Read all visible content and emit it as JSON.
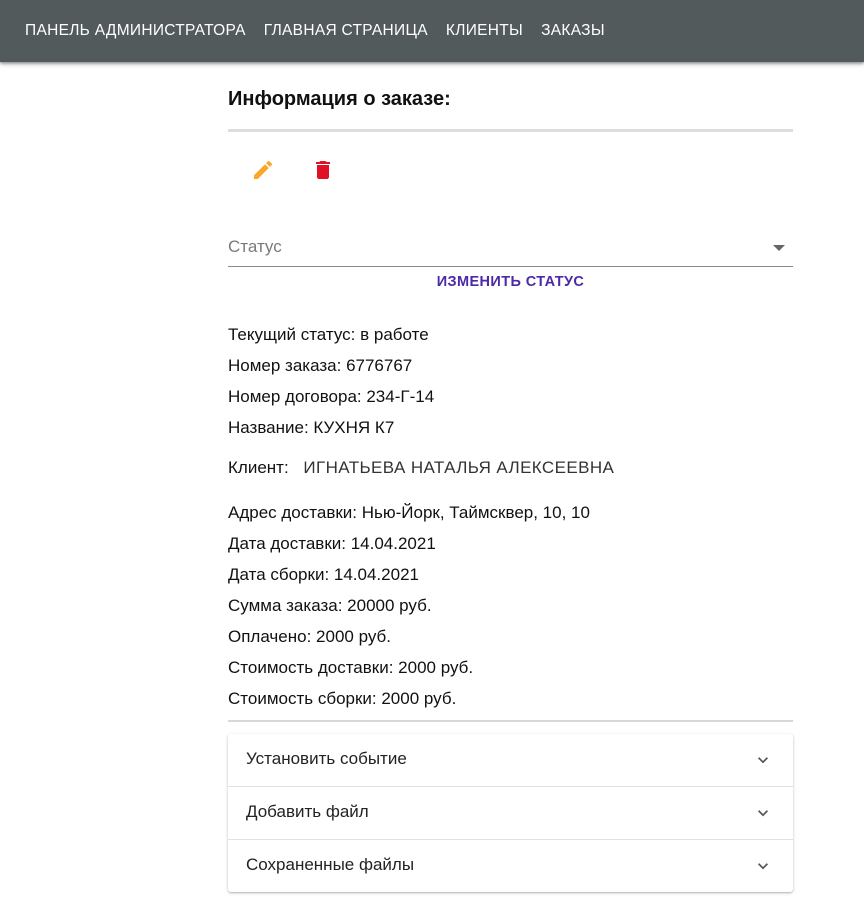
{
  "nav": {
    "items": [
      {
        "label": "ПАНЕЛЬ АДМИНИСТРАТОРА"
      },
      {
        "label": "ГЛАВНАЯ СТРАНИЦА"
      },
      {
        "label": "КЛИЕНТЫ"
      },
      {
        "label": "ЗАКАЗЫ"
      }
    ]
  },
  "page": {
    "title": "Информация о заказе:"
  },
  "actions": {
    "edit_icon": "pencil-icon",
    "delete_icon": "trash-icon",
    "edit_color": "#f9a825",
    "delete_color": "#e01025"
  },
  "status": {
    "placeholder": "Статус",
    "change_label": "ИЗМЕНИТЬ СТАТУС"
  },
  "order": {
    "current_status": "Текущий статус: в работе",
    "order_number": "Номер заказа: 6776767",
    "contract_number": "Номер договора: 234-Г-14",
    "name": "Название: КУХНЯ К7",
    "client_label": "Клиент:",
    "client_name": "ИГНАТЬЕВА НАТАЛЬЯ АЛЕКСЕЕВНА",
    "delivery_address": "Адрес доставки: Нью-Йорк, Таймсквер, 10, 10",
    "delivery_date": "Дата доставки: 14.04.2021",
    "assembly_date": "Дата сборки: 14.04.2021",
    "total": "Сумма заказа: 20000 руб.",
    "paid": "Оплачено: 2000 руб.",
    "delivery_cost": "Стоимость доставки: 2000 руб.",
    "assembly_cost": "Стоимость сборки: 2000 руб."
  },
  "panels": [
    {
      "label": "Установить событие"
    },
    {
      "label": "Добавить файл"
    },
    {
      "label": "Сохраненные файлы"
    }
  ]
}
